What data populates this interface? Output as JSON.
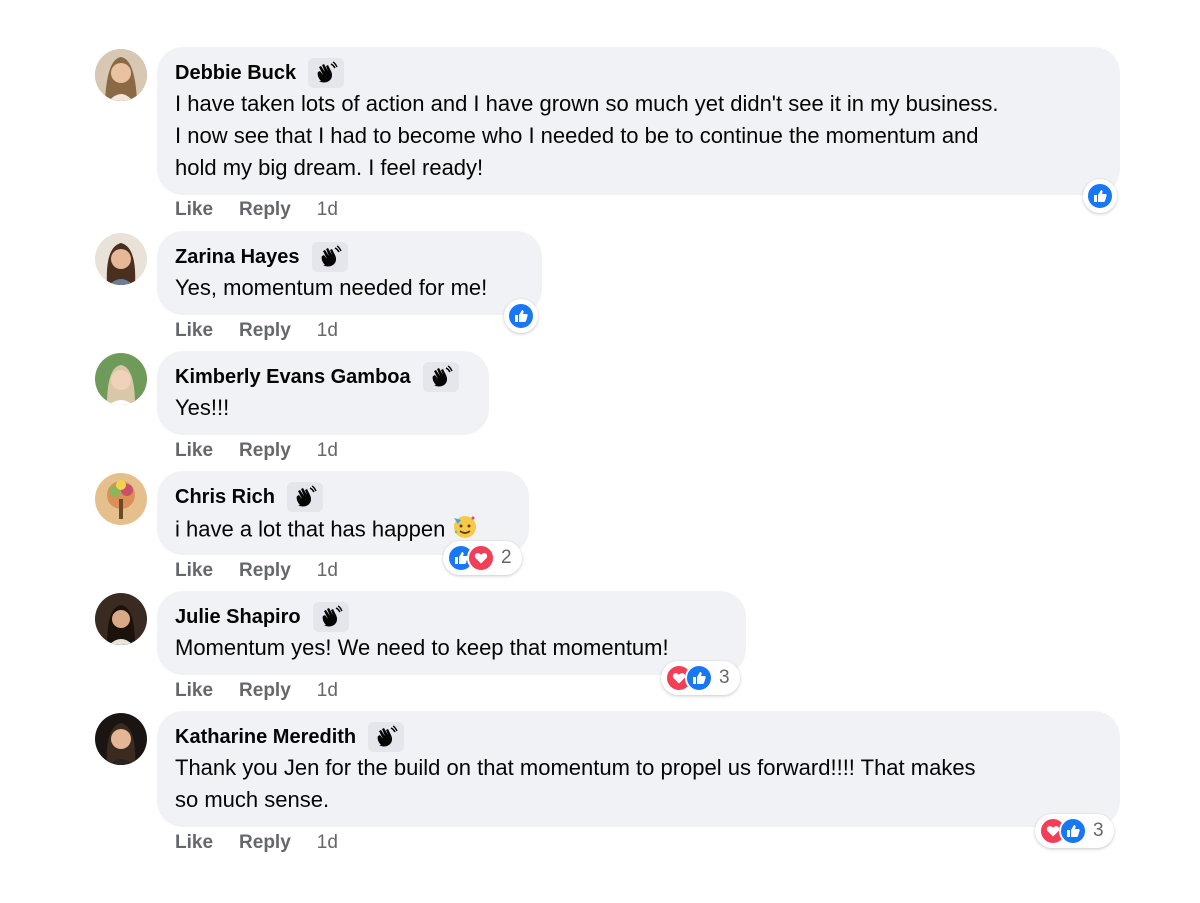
{
  "comments": [
    {
      "author": "Debbie Buck",
      "lines": [
        "I have taken lots of action and I have grown so much yet didn't see it in my business.",
        "I now see that I had to become who I needed to be to continue the momentum and",
        "hold my big dream. I feel ready!"
      ],
      "like": "Like",
      "reply": "Reply",
      "time": "1d",
      "reactions": [
        "like"
      ],
      "reaction_count": ""
    },
    {
      "author": "Zarina Hayes",
      "lines": [
        "Yes, momentum needed for me!"
      ],
      "like": "Like",
      "reply": "Reply",
      "time": "1d",
      "reactions": [
        "like"
      ],
      "reaction_count": ""
    },
    {
      "author": "Kimberly Evans Gamboa",
      "lines": [
        "Yes!!!"
      ],
      "like": "Like",
      "reply": "Reply",
      "time": "1d",
      "reactions": [],
      "reaction_count": ""
    },
    {
      "author": "Chris Rich",
      "lines": [
        "i have a lot that has happen"
      ],
      "emoji": "party-face",
      "like": "Like",
      "reply": "Reply",
      "time": "1d",
      "reactions": [
        "like",
        "love"
      ],
      "reaction_count": "2"
    },
    {
      "author": "Julie Shapiro",
      "lines": [
        "Momentum yes! We need to keep that momentum!"
      ],
      "like": "Like",
      "reply": "Reply",
      "time": "1d",
      "reactions": [
        "love",
        "like"
      ],
      "reaction_count": "3"
    },
    {
      "author": "Katharine Meredith",
      "lines": [
        "Thank you Jen for the build on that momentum to propel us forward!!!! That makes",
        "so much sense."
      ],
      "like": "Like",
      "reply": "Reply",
      "time": "1d",
      "reactions": [
        "love",
        "like"
      ],
      "reaction_count": "3"
    }
  ],
  "icons": {
    "badge": "waving-hand-icon",
    "like": "thumbs-up-icon",
    "love": "heart-icon"
  },
  "colors": {
    "like": "#1877f2",
    "love": "#f33e58",
    "bubble": "#f0f2f5",
    "meta": "#65676b"
  }
}
